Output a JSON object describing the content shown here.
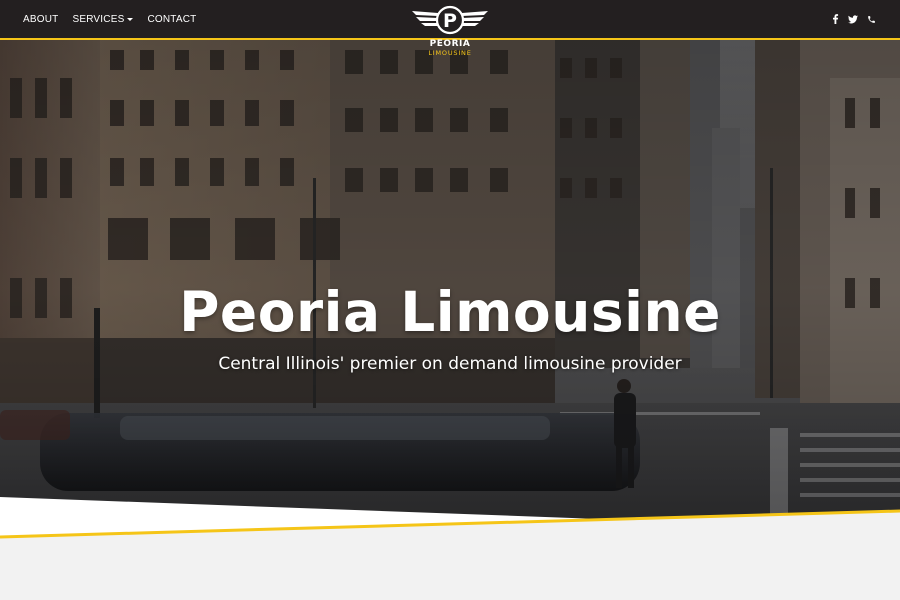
{
  "nav": {
    "about": "ABOUT",
    "services": "SERVICES",
    "contact": "CONTACT"
  },
  "logo": {
    "letter": "P",
    "wordmark": "PEORIA",
    "subtext": "LIMOUSINE"
  },
  "social": {
    "facebook": "f",
    "twitter": "t",
    "phone": "☏"
  },
  "hero": {
    "title": "Peoria Limousine",
    "subtitle": "Central Illinois' premier on demand limousine provider"
  },
  "colors": {
    "navbar": "#231f20",
    "accent": "#f5c518",
    "page": "#f2f2f2"
  },
  "icons": [
    "winged-logo-icon",
    "facebook-icon",
    "twitter-icon",
    "phone-icon",
    "caret-down-icon"
  ]
}
